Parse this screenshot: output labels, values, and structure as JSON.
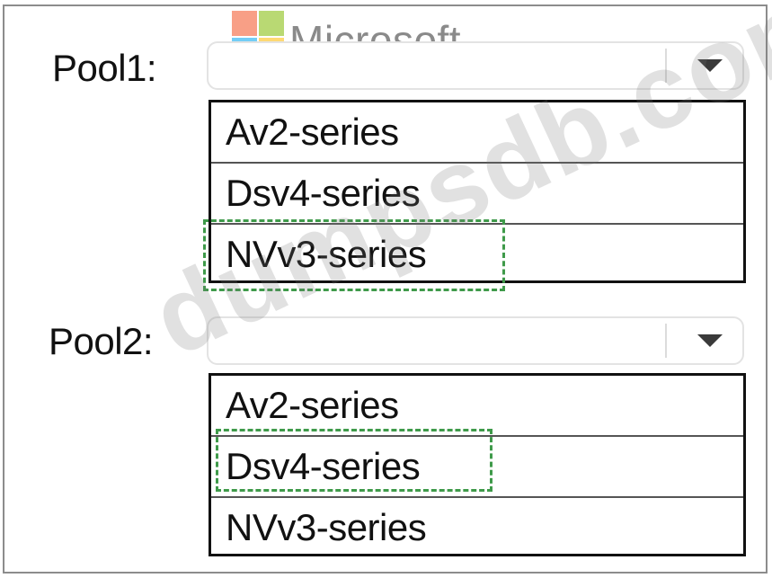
{
  "logo": {
    "text": "Microsoft"
  },
  "watermark": {
    "text": "dumpsdb.com"
  },
  "pools": [
    {
      "label": "Pool1:",
      "selected_value": "",
      "options": [
        "Av2-series",
        "Dsv4-series",
        "NVv3-series"
      ],
      "highlighted_option": "NVv3-series"
    },
    {
      "label": "Pool2:",
      "selected_value": "",
      "options": [
        "Av2-series",
        "Dsv4-series",
        "NVv3-series"
      ],
      "highlighted_option": "Dsv4-series"
    }
  ],
  "colors": {
    "highlight": "#3f9a4a",
    "border": "#111111"
  },
  "icons": {
    "dropdown": "chevron-down-icon"
  }
}
